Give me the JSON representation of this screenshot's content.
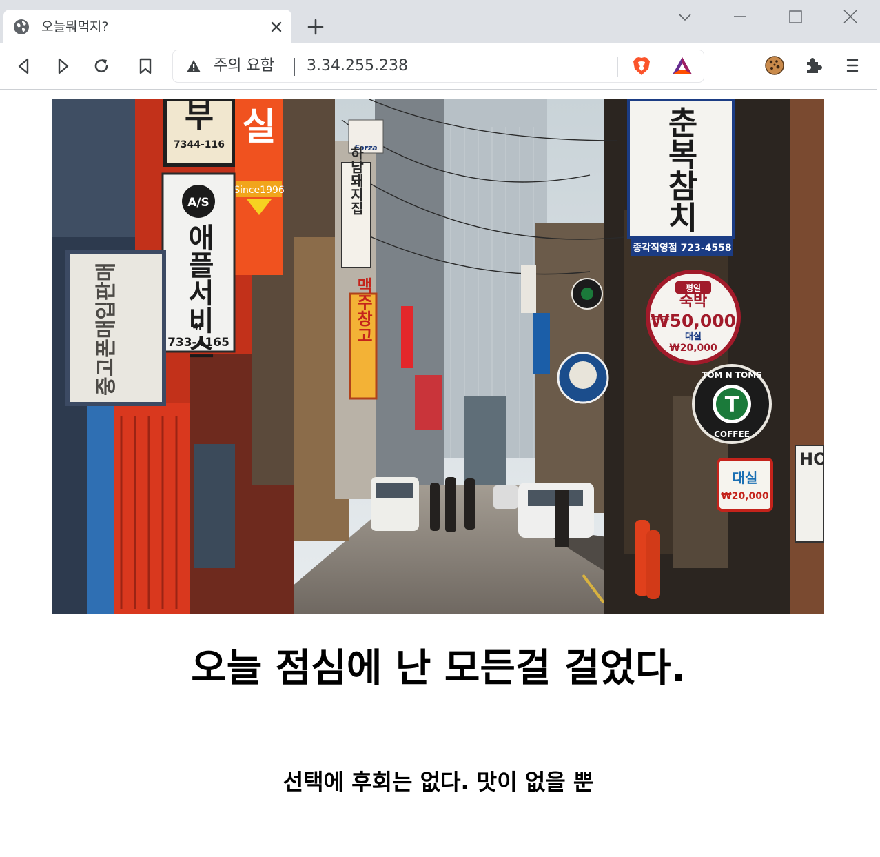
{
  "browser": {
    "tab": {
      "title": "오늘뭐먹지?",
      "favicon": "globe-icon"
    },
    "address_bar": {
      "security_label": "주의 요함",
      "url": "3.34.255.238"
    },
    "accent_colors": {
      "brave": "#fb542b",
      "bat_top": "#9e1f63",
      "bat_side": "#662d91",
      "bat_base": "#ff5000"
    }
  },
  "page": {
    "headline": "오늘 점심에 난 모든걸 걸었다.",
    "subtitle": "선택에 후회는 없다. 맛이 없을 뿐"
  },
  "hero_image": {
    "signs": {
      "top_left_sign": "부",
      "top_left_phone": "7344-116",
      "apple_logo": "A/S",
      "apple_name": "애플서비스",
      "apple_floor": "4F",
      "apple_phone": "733-4165",
      "left_vertical": "중고폰매입판매",
      "orange_sign": "실",
      "orange_since": "Since1996",
      "hanam": "하남돼지집",
      "beer_sign": "맥주창고",
      "chunbok": "춘복참치",
      "chunbok_branch": "종각직영점 723-4558",
      "motel_small": "평일",
      "motel_top": "숙박",
      "motel_price": "₩50,000",
      "motel_rent": "대실",
      "motel_rent_price": "₩20,000",
      "toms_name": "TOM N TOMS",
      "toms_logo": "T",
      "toms_coffee": "COFFEE",
      "rent_label": "대실",
      "rent_price": "₩20,000",
      "right_edge": "HO",
      "forza": "Forza"
    }
  }
}
